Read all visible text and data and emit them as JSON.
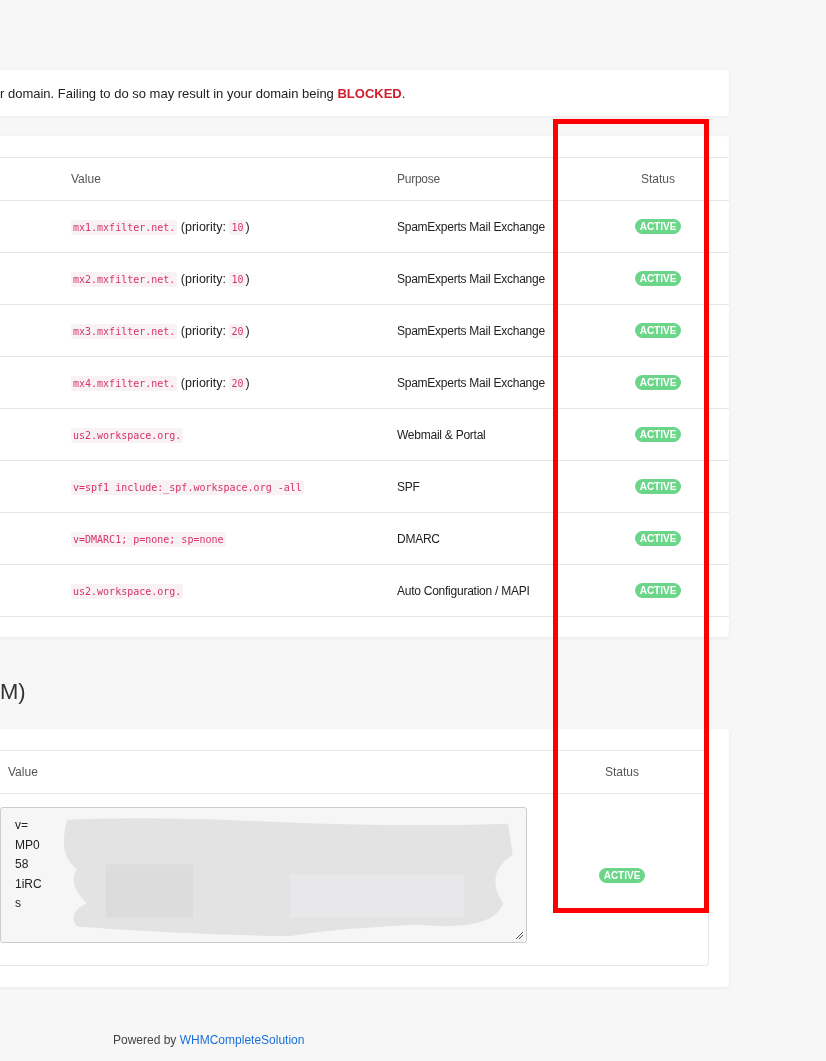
{
  "notice": {
    "text": "r domain. Failing to do so may result in your domain being **BLOCKED**."
  },
  "records_table": {
    "columns": [
      "Value",
      "Purpose",
      "Status"
    ],
    "rows": [
      {
        "value": "mx1.mxfilter.net.",
        "priority_prefix": "(priority:",
        "priority": "10",
        "priority_suffix": ")",
        "purpose": "SpamExperts Mail Exchange",
        "status": "ACTIVE"
      },
      {
        "value": "mx2.mxfilter.net.",
        "priority_prefix": "(priority:",
        "priority": "10",
        "priority_suffix": ")",
        "purpose": "SpamExperts Mail Exchange",
        "status": "ACTIVE"
      },
      {
        "value": "mx3.mxfilter.net.",
        "priority_prefix": "(priority:",
        "priority": "20",
        "priority_suffix": ")",
        "purpose": "SpamExperts Mail Exchange",
        "status": "ACTIVE"
      },
      {
        "value": "mx4.mxfilter.net.",
        "priority_prefix": "(priority:",
        "priority": "20",
        "priority_suffix": ")",
        "purpose": "SpamExperts Mail Exchange",
        "status": "ACTIVE"
      },
      {
        "value": "us2.workspace.org.",
        "purpose": "Webmail & Portal",
        "status": "ACTIVE"
      },
      {
        "value": "v=spf1 include:_spf.workspace.org -all",
        "purpose": "SPF",
        "status": "ACTIVE"
      },
      {
        "value": "v=DMARC1; p=none; sp=none",
        "purpose": "DMARC",
        "status": "ACTIVE"
      },
      {
        "value": "us2.workspace.org.",
        "purpose": "Auto Configuration / MAPI",
        "status": "ACTIVE"
      }
    ]
  },
  "dkim_heading": "M)",
  "dkim_table": {
    "columns": [
      "Value",
      "Status"
    ],
    "rows": [
      {
        "value_lines": [
          "v=",
          "MP0",
          "58",
          "1iRC",
          "s"
        ],
        "redacted": true,
        "status": "ACTIVE"
      }
    ]
  },
  "footer": {
    "text": "Powered by",
    "link": "WHMCompleteSolution"
  },
  "annotations": [
    {
      "kind": "rectangle"
    }
  ]
}
